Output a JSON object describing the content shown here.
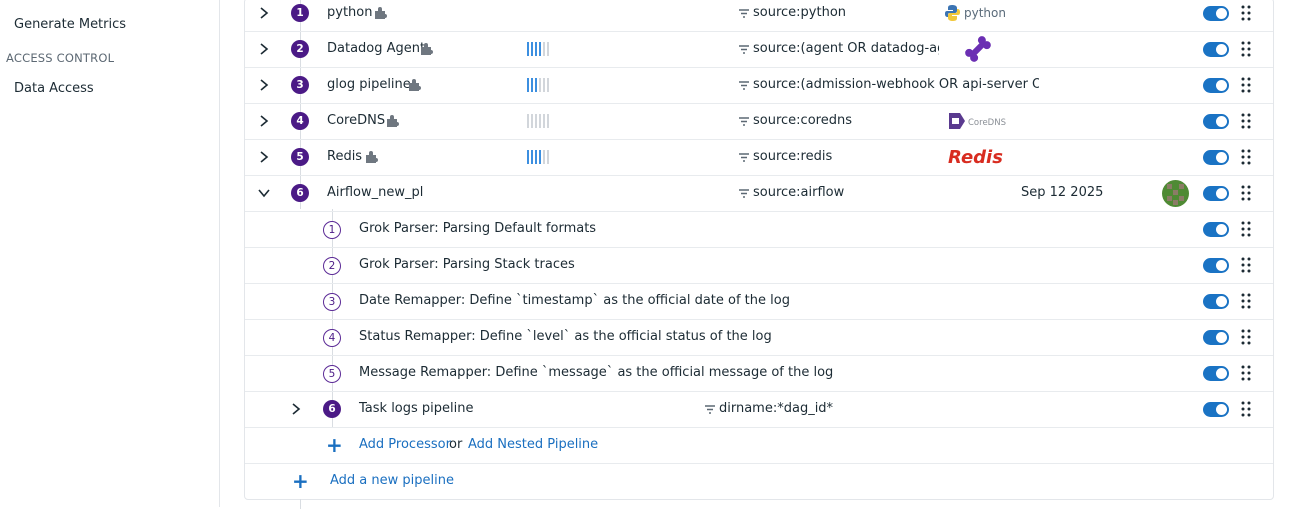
{
  "sidebar": {
    "generate_metrics": "Generate Metrics",
    "access_control_section": "ACCESS CONTROL",
    "data_access": "Data Access"
  },
  "pipelines": [
    {
      "index": "1",
      "name": "python",
      "query": "source:python",
      "logo": "python",
      "enabled": true
    },
    {
      "index": "2",
      "name": "Datadog Agent",
      "query": "source:(agent OR datadog-age…",
      "logo": "bone-icon",
      "enabled": true
    },
    {
      "index": "3",
      "name": "glog pipeline",
      "query": "source:(admission-webhook OR api-server O…",
      "logo": "",
      "enabled": true
    },
    {
      "index": "4",
      "name": "CoreDNS",
      "query": "source:coredns",
      "logo": "CoreDNS",
      "enabled": true
    },
    {
      "index": "5",
      "name": "Redis",
      "query": "source:redis",
      "logo": "Redis",
      "enabled": true
    },
    {
      "index": "6",
      "name": "Airflow_new_pl",
      "query": "source:airflow",
      "date": "Sep 12 2025",
      "enabled": true
    }
  ],
  "processors": [
    {
      "index": "1",
      "name": "Grok Parser: Parsing Default formats",
      "enabled": true
    },
    {
      "index": "2",
      "name": "Grok Parser: Parsing Stack traces",
      "enabled": true
    },
    {
      "index": "3",
      "name": "Date Remapper: Define `timestamp` as the official date of the log",
      "enabled": true
    },
    {
      "index": "4",
      "name": "Status Remapper: Define `level` as the official status of the log",
      "enabled": true
    },
    {
      "index": "5",
      "name": "Message Remapper: Define `message` as the official message of the log",
      "enabled": true
    }
  ],
  "nested_pipeline": {
    "index": "6",
    "name": "Task logs pipeline",
    "query": "dirname:*dag_id*",
    "enabled": true
  },
  "actions": {
    "add_processor": "Add Processor",
    "or": "or",
    "add_nested_pipeline": "Add Nested Pipeline",
    "add_new_pipeline": "Add a new pipeline"
  },
  "colors": {
    "accent_purple": "#4b1a86",
    "toggle_blue": "#1a73c4",
    "link_blue": "#1a6fc0",
    "redis_red": "#d82c20"
  }
}
